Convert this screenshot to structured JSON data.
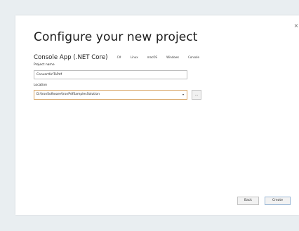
{
  "dialog": {
    "title": "Configure your new project",
    "close_glyph": "×",
    "template": {
      "name": "Console App (.NET Core)",
      "tags": [
        "C#",
        "Linux",
        "macOS",
        "Windows",
        "Console"
      ]
    },
    "project_name": {
      "label": "Project name",
      "value": "ConvertUrlToPdf"
    },
    "location": {
      "label": "Location",
      "value": "D:\\IronSoftware\\IronPdfSamplesSolution",
      "browse_label": "..."
    },
    "buttons": {
      "back_label": "Back",
      "create_label": "Create"
    }
  },
  "icons": {
    "close": "close-icon",
    "dropdown": "chevron-down-icon"
  },
  "colors": {
    "background": "#e9eef1",
    "focus_border": "#d8a667",
    "primary_border": "#9ab7d6"
  }
}
